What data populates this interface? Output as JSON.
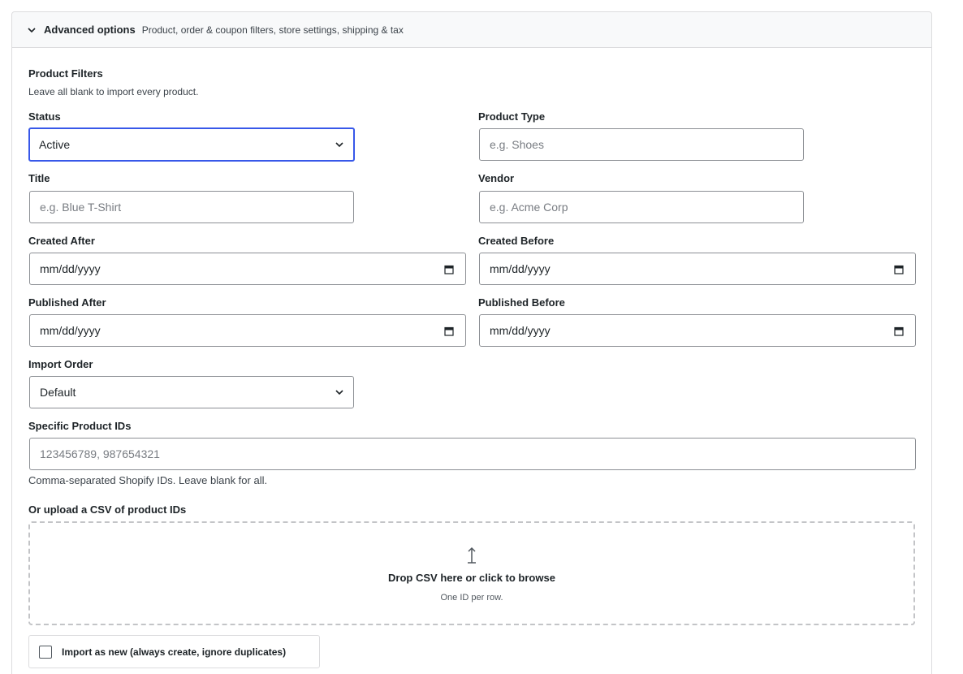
{
  "panel": {
    "title": "Advanced options",
    "subtitle": "Product, order & coupon filters, store settings, shipping & tax",
    "icon": "chevron-down-icon"
  },
  "product_filters": {
    "title": "Product Filters",
    "help": "Leave all blank to import every product."
  },
  "fields": {
    "status": {
      "label": "Status",
      "value": "Active"
    },
    "product_type": {
      "label": "Product Type",
      "placeholder": "e.g. Shoes"
    },
    "title": {
      "label": "Title",
      "placeholder": "e.g. Blue T-Shirt"
    },
    "vendor": {
      "label": "Vendor",
      "placeholder": "e.g. Acme Corp"
    },
    "created_after": {
      "label": "Created After",
      "value": "mm/dd/yyyy"
    },
    "created_before": {
      "label": "Created Before",
      "value": "mm/dd/yyyy"
    },
    "published_after": {
      "label": "Published After",
      "value": "mm/dd/yyyy"
    },
    "published_before": {
      "label": "Published Before",
      "value": "mm/dd/yyyy"
    },
    "import_order": {
      "label": "Import Order",
      "value": "Default"
    },
    "product_ids": {
      "label": "Specific Product IDs",
      "placeholder": "123456789, 987654321",
      "help": "Comma-separated Shopify IDs. Leave blank for all."
    }
  },
  "csv_upload": {
    "label": "Or upload a CSV of product IDs",
    "drop_title": "Drop CSV here or click to browse",
    "drop_sub": "One ID per row.",
    "icon": "upload-arrow-icon"
  },
  "import_as_new": {
    "label": "Import as new (always create, ignore duplicates)",
    "checked": false
  },
  "colors": {
    "focus": "#3858e9",
    "border": "#8c8f94",
    "header_bg": "#f8f9fa"
  }
}
